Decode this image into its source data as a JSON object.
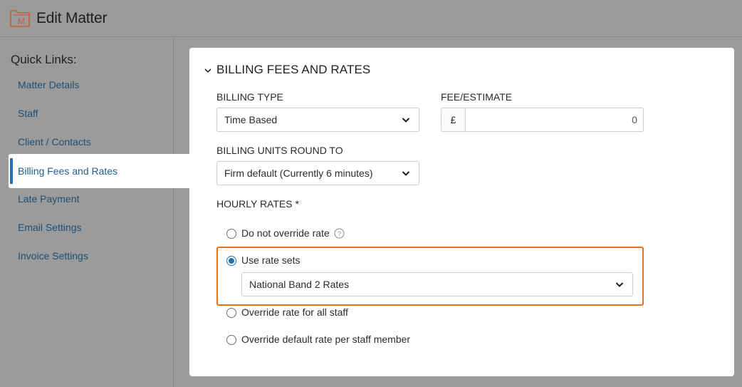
{
  "header": {
    "title": "Edit Matter",
    "logo_icon": "matter-folder-icon"
  },
  "sidebar": {
    "title": "Quick Links:",
    "items": [
      {
        "label": "Matter Details"
      },
      {
        "label": "Staff"
      },
      {
        "label": "Client / Contacts"
      },
      {
        "label": "Billing Fees and Rates",
        "active": true
      },
      {
        "label": "Late Payment"
      },
      {
        "label": "Email Settings"
      },
      {
        "label": "Invoice Settings"
      }
    ]
  },
  "billing": {
    "section_title": "BILLING FEES AND RATES",
    "billing_type": {
      "label": "BILLING TYPE",
      "value": "Time Based"
    },
    "fee_estimate": {
      "label": "FEE/ESTIMATE",
      "currency": "£",
      "value": "0"
    },
    "units_round": {
      "label": "BILLING UNITS ROUND TO",
      "value": "Firm default (Currently 6 minutes)"
    },
    "hourly_rates": {
      "label": "HOURLY RATES *",
      "options": [
        {
          "label": "Do not override rate",
          "checked": false
        },
        {
          "label": "Use rate sets",
          "checked": true
        },
        {
          "label": "Override rate for all staff",
          "checked": false
        },
        {
          "label": "Override default rate per staff member",
          "checked": false
        }
      ],
      "rate_set_value": "National Band 2 Rates"
    }
  },
  "colors": {
    "accent": "#1e73b0",
    "highlight": "#e8701a",
    "logo": "#c0623a",
    "background": "#9b9b9b"
  }
}
